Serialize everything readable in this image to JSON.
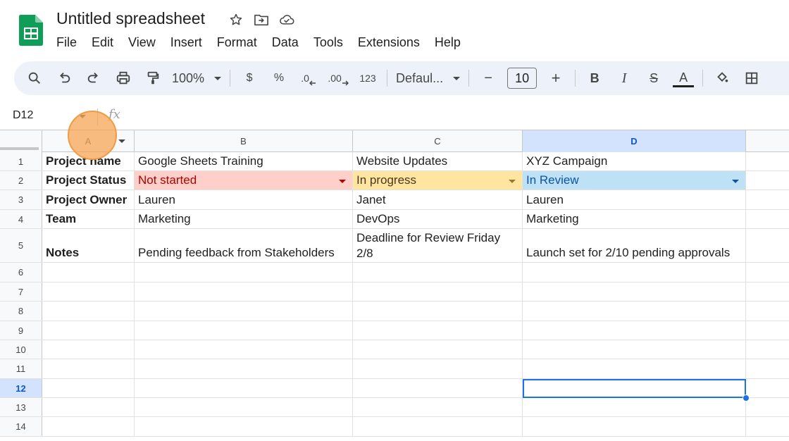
{
  "app": {
    "title": "Untitled spreadsheet",
    "icons": [
      "sheets-logo-icon",
      "star-icon",
      "move-folder-icon",
      "cloud-saved-icon"
    ],
    "brand_color": "#0f9d58"
  },
  "menubar": [
    "File",
    "Edit",
    "View",
    "Insert",
    "Format",
    "Data",
    "Tools",
    "Extensions",
    "Help"
  ],
  "toolbar": {
    "zoom": "100%",
    "currency": "$",
    "percent": "%",
    "decrease_decimal": ".0",
    "increase_decimal": ".00",
    "number_format": "123",
    "font": "Defaul...",
    "font_size": "10",
    "minus": "−",
    "plus": "+",
    "bold": "B",
    "italic": "I",
    "strikethrough": "S",
    "text_color": "A"
  },
  "formula_bar": {
    "cell_ref": "D12",
    "fx": "fx"
  },
  "columns": [
    "A",
    "B",
    "C",
    "D"
  ],
  "selected_column": "D",
  "rows": [
    "1",
    "2",
    "3",
    "4",
    "5",
    "6",
    "7",
    "8",
    "9",
    "10",
    "11",
    "12",
    "13",
    "14"
  ],
  "selected_row": "12",
  "cells": {
    "r1": [
      "Project name",
      "Google Sheets Training",
      "Website Updates",
      "XYZ Campaign"
    ],
    "r2": [
      "Project Status",
      "Not started",
      "In progress",
      "In Review"
    ],
    "r3": [
      "Project Owner",
      "Lauren",
      "Janet",
      "Lauren"
    ],
    "r4": [
      "Team",
      "Marketing",
      "DevOps",
      "Marketing"
    ],
    "r5": [
      "Notes",
      "Pending feedback from Stakeholders",
      "Deadline for Review Friday 2/8",
      "Launch set for 2/10 pending approvals"
    ]
  },
  "status_colors": {
    "not_started": "#ffcfc9",
    "in_progress": "#ffe5a0",
    "in_review": "#bfe1f6"
  }
}
